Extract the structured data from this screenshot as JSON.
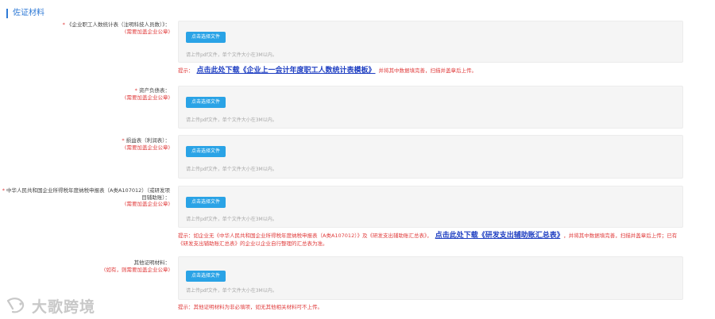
{
  "section": {
    "title": "佐证材料"
  },
  "common": {
    "upload_button": "点击选择文件",
    "upload_hint": "请上传pdf文件，单个文件大小在3M以内。"
  },
  "rows": [
    {
      "label": "《企业职工人数统计表（注明科技人员数）》：",
      "sublabel": "(需要加盖企业公章)"
    },
    {
      "label": "资产负债表：",
      "sublabel": "(需要加盖企业公章)"
    },
    {
      "label": "损益表（利润表）：",
      "sublabel": "(需要加盖企业公章)"
    },
    {
      "label": "中华人民共和国企业所得税年度纳税申报表（A类A107012）（或研发项目辅助账）：",
      "sublabel": "(需要加盖企业公章)"
    },
    {
      "label": "其他证明材料：",
      "sublabel": "(如有，则需要加盖企业公章)"
    }
  ],
  "tips": {
    "tip1_prefix": "提示：",
    "tip1_link": "点击此处下载《企业上一会计年度职工人数统计表模板》",
    "tip1_suffix": "并将其中数据填完善，扫描并盖章后上传。",
    "tip2_prefix": "提示：如企业无《中华人民共和国企业所得税年度纳税申报表（A类A107012）》及《研发支出辅助账汇总表》，",
    "tip2_link": "点击此处下载《研发支出辅助账汇总表》",
    "tip2_suffix": "，并将其中数据填完善，扫描并盖章后上传；已有《研发支出辅助账汇总表》的企业以企业自行整理的汇总表为准。",
    "tip3": "提示：其他证明材料为非必填项，如无其他相关材料可不上传。"
  },
  "watermark": {
    "text": "大歌跨境"
  }
}
